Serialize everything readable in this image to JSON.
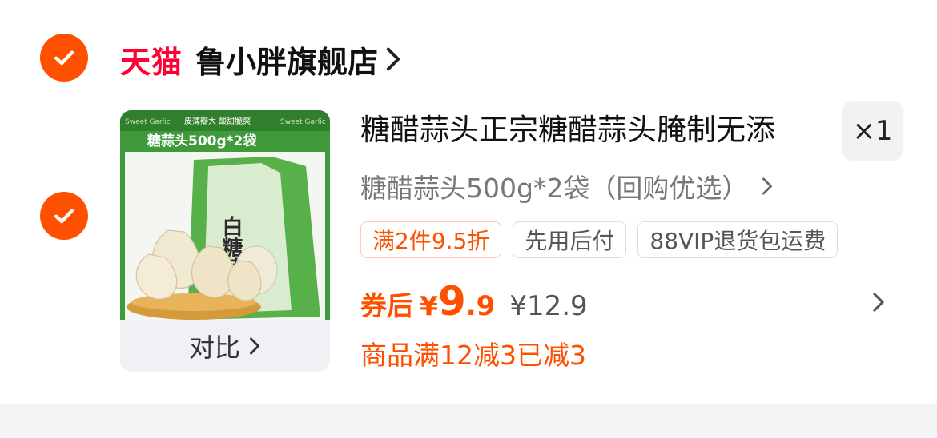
{
  "store": {
    "brand": "天猫",
    "name": "鲁小胖旗舰店"
  },
  "product": {
    "title": "糖醋蒜头正宗糖醋蒜头腌制无添",
    "quantity": "×1",
    "sku": "糖醋蒜头500g*2袋（回购优选）",
    "image": {
      "banner_left": "Sweet Garlic",
      "banner_mid": "皮薄瓣大  酸甜脆爽",
      "banner_right": "Sweet Garlic",
      "headline": "糖蒜头500g*2袋",
      "bag_text": "白糖蒜"
    },
    "compare_label": "对比",
    "tags": [
      "满2件9.5折",
      "先用后付",
      "88VIP退货包运费"
    ],
    "price": {
      "label": "券后",
      "currency": "¥",
      "integer": "9",
      "decimal": ".9",
      "original": "¥12.9"
    },
    "discount_text": "商品满12减3已减3"
  },
  "colors": {
    "accent": "#ff5000",
    "tmall": "#ff0036",
    "image_green": "#3f9a3a"
  }
}
